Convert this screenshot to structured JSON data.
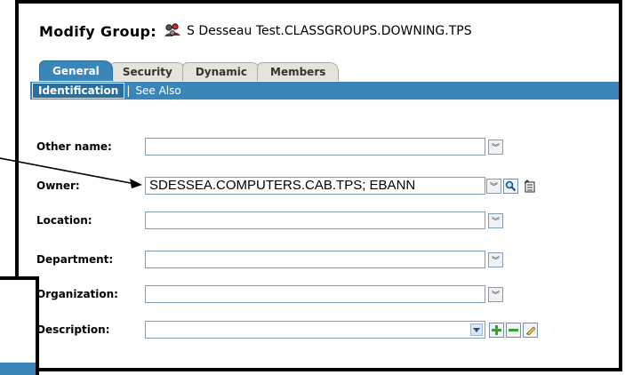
{
  "header": {
    "title_label": "Modify Group:",
    "group_name": "S Desseau Test.CLASSGROUPS.DOWNING.TPS",
    "group_icon": "group-users-icon"
  },
  "tabs": [
    {
      "label": "General",
      "active": true
    },
    {
      "label": "Security",
      "active": false
    },
    {
      "label": "Dynamic",
      "active": false
    },
    {
      "label": "Members",
      "active": false
    }
  ],
  "subtabs": {
    "identification": "Identification",
    "separator": "|",
    "see_also": "See Also"
  },
  "form": {
    "other_name": {
      "label": "Other name:",
      "value": ""
    },
    "owner": {
      "label": "Owner:",
      "value": "SDESSEA.COMPUTERS.CAB.TPS; EBANN"
    },
    "location": {
      "label": "Location:",
      "value": ""
    },
    "department": {
      "label": "Department:",
      "value": ""
    },
    "organization": {
      "label": "Organization:",
      "value": ""
    },
    "description": {
      "label": "Description:",
      "value": ""
    }
  },
  "colors": {
    "tab_active": "#3b86b8",
    "field_border": "#7e9db9"
  }
}
